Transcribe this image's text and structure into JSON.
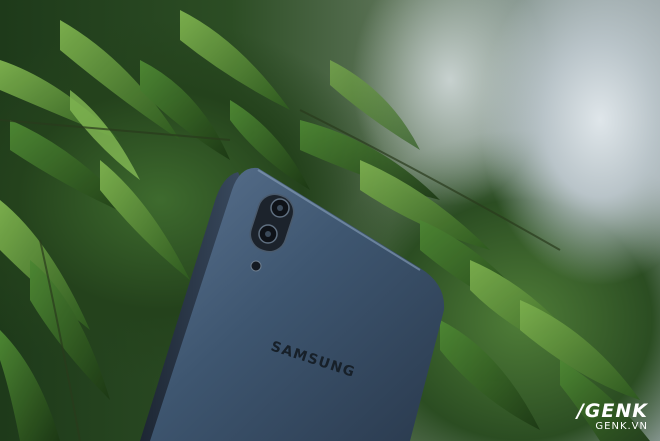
{
  "photo": {
    "subject": "Samsung phone back with dual camera",
    "phone_logo": "SAMSUNG",
    "phone_color": "#3c5168",
    "foliage_color": "#3f7a2e"
  },
  "watermark": {
    "brand": "/GENK",
    "domain": "GENK.VN"
  }
}
